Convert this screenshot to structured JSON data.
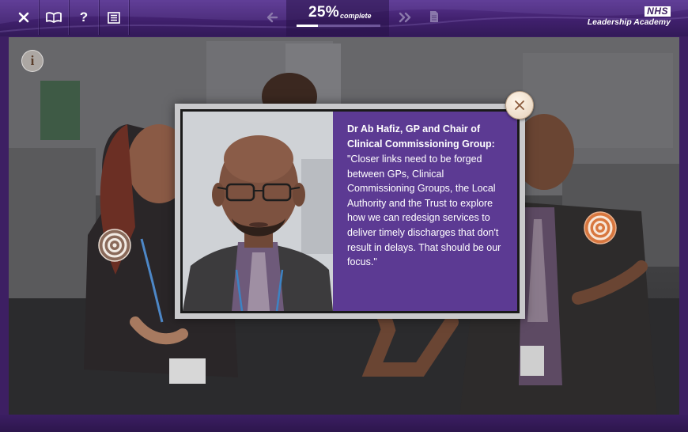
{
  "toolbar": {
    "close_icon": "close-icon",
    "book_icon": "book-icon",
    "help_label": "?",
    "list_icon": "list-icon"
  },
  "progress": {
    "percent_text": "25%",
    "label": "complete",
    "fraction": 0.25
  },
  "brand": {
    "nhs": "NHS",
    "name": "Leadership Academy"
  },
  "scene": {
    "info_label": "i",
    "hotspots": [
      "target-icon",
      "target-icon"
    ]
  },
  "dialog": {
    "speaker": "Dr Ab Hafiz, GP and Chair of Clinical Commissioning Group:",
    "quote": "\"Closer links need to be forged between GPs, Clinical Commissioning Groups, the Local Authority and the Trust to explore how we can redesign services to deliver timely discharges that don't result in delays. That should be our focus.\""
  },
  "colors": {
    "brand_purple": "#3d1f63",
    "quote_panel": "#5c3a93",
    "hotspot_active": "#d8773f"
  }
}
